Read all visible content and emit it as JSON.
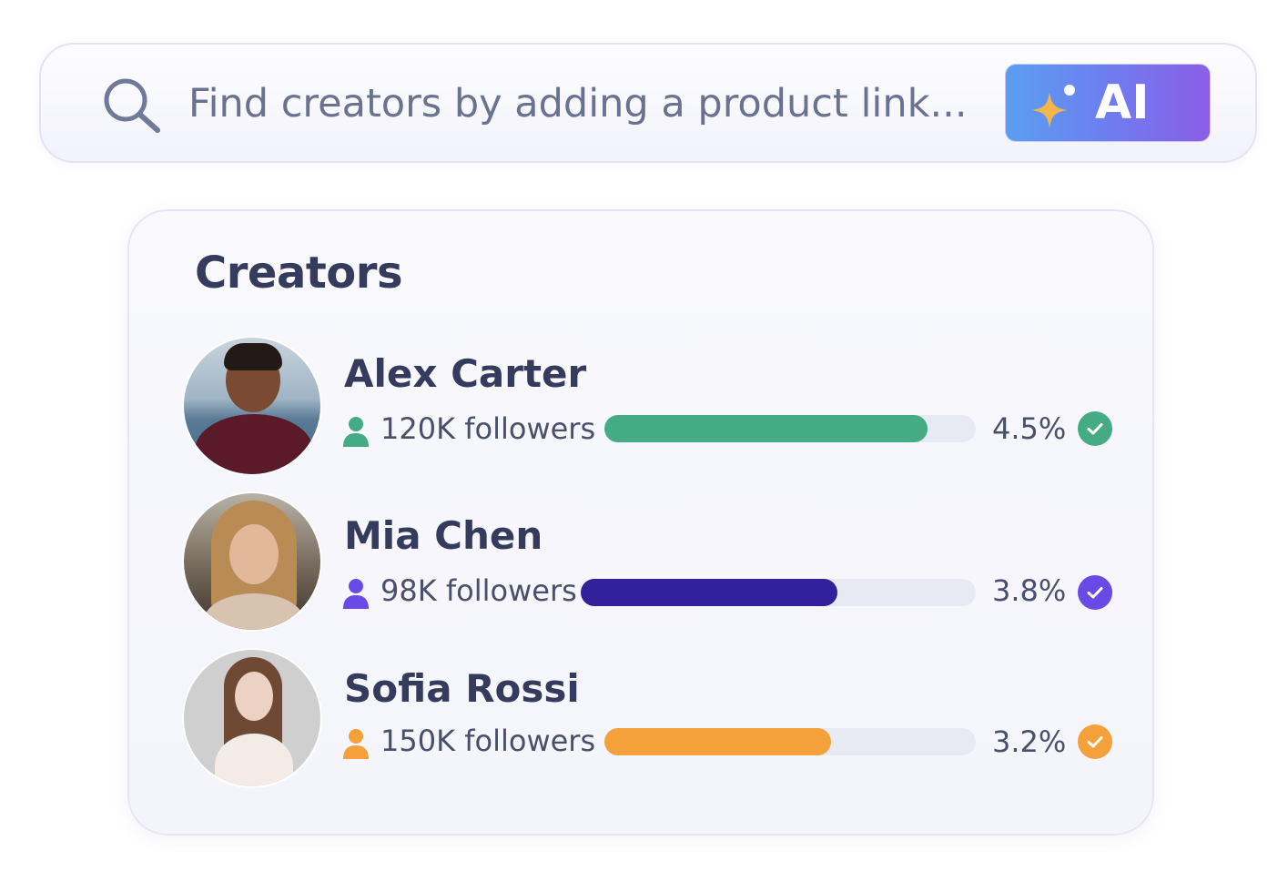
{
  "search": {
    "placeholder": "Find creators by adding a product link...",
    "button_label": "AI"
  },
  "panel": {
    "title": "Creators"
  },
  "creators": [
    {
      "name": "Alex Carter",
      "followers": "120K followers",
      "rate": "4.5%",
      "bar_fraction": 0.87,
      "color": "#45ab85",
      "icon": "user-icon",
      "badge_icon": "check-icon"
    },
    {
      "name": "Mia Chen",
      "followers": "98K followers",
      "rate": "3.8%",
      "bar_fraction": 0.65,
      "color": "#33209b",
      "icon": "user-icon",
      "badge_icon": "check-icon"
    },
    {
      "name": "Sofia Rossi",
      "followers": "150K followers",
      "rate": "3.2%",
      "bar_fraction": 0.61,
      "color": "#f4a03b",
      "icon": "user-icon",
      "badge_icon": "check-icon"
    }
  ],
  "colors": {
    "accent_gradient_start": "#5a9ff0",
    "accent_gradient_end": "#8a5ee6",
    "sparkle": "#f5b54a",
    "check_purple": "#6a4ae6"
  }
}
